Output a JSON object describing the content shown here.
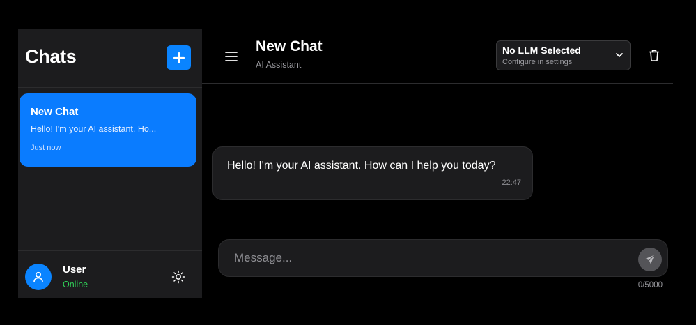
{
  "sidebar": {
    "title": "Chats",
    "new_chat_icon": "plus-icon",
    "chats": [
      {
        "title": "New Chat",
        "preview": "Hello! I'm your AI assistant. Ho...",
        "time": "Just now",
        "active": true
      }
    ],
    "user": {
      "name": "User",
      "status": "Online",
      "avatar_icon": "user-icon"
    },
    "settings_icon": "sun-icon"
  },
  "header": {
    "menu_icon": "hamburger-icon",
    "title": "New Chat",
    "subtitle": "AI Assistant",
    "llm_select": {
      "label": "No LLM Selected",
      "hint": "Configure in settings"
    },
    "delete_icon": "trash-icon"
  },
  "messages": [
    {
      "role": "assistant",
      "text": "Hello! I'm your AI assistant. How can I help you today?",
      "time": "22:47"
    }
  ],
  "composer": {
    "value": "",
    "placeholder": "Message...",
    "counter": "0/5000",
    "send_icon": "send-icon"
  },
  "colors": {
    "accent": "#0a84ff",
    "background": "#000000",
    "panel": "#1c1c1e",
    "online": "#30d158"
  }
}
